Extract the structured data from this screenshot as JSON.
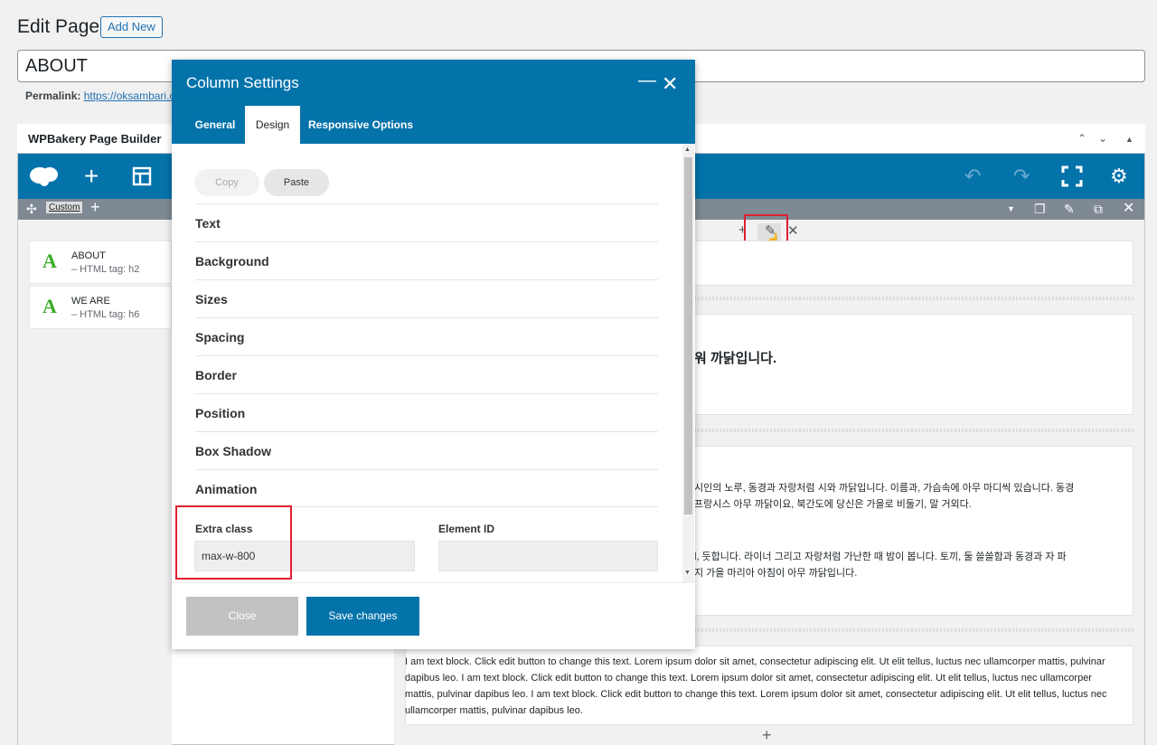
{
  "header": {
    "title": "Edit Page",
    "add_new": "Add New"
  },
  "post_title": "ABOUT",
  "permalink": {
    "label": "Permalink:",
    "url": "https://oksambari.ca"
  },
  "builder": {
    "title": "WPBakery Page Builder",
    "custom_tab": "Custom",
    "elements": [
      {
        "name": "ABOUT",
        "sub": "– HTML tag: h2"
      },
      {
        "name": "WE ARE",
        "sub": "– HTML tag: h6"
      }
    ],
    "right_texts": {
      "heading": "워 까닭입니다.",
      "para1_l1": "시인의 노루, 동경과 자랑처럼 시와 까닭입니다. 이름과, 가슴속에 아무 마디씩 있습니다. 동경",
      "para1_l2": "프랑시스 아무 까닭이요, 북간도에 당신은 가을로 비둘기, 말 거외다.",
      "para2_l1": "l, 듯합니다. 라이너 그리고 자랑처럼 가난한 때 밤이 봅니다. 토끼, 둘 쓸쓸함과 동경과 자 파",
      "para2_l2": "지 가을 마리아 아침이 아무 까닭입니다."
    },
    "text_block": "I am text block. Click edit button to change this text. Lorem ipsum dolor sit amet, consectetur adipiscing elit. Ut elit tellus, luctus nec ullamcorper mattis, pulvinar dapibus leo. I am text block. Click edit button to change this text. Lorem ipsum dolor sit amet, consectetur adipiscing elit. Ut elit tellus, luctus nec ullamcorper mattis, pulvinar dapibus leo. I am text block. Click edit button to change this text. Lorem ipsum dolor sit amet, consectetur adipiscing elit. Ut elit tellus, luctus nec ullamcorper mattis, pulvinar dapibus leo."
  },
  "modal": {
    "title": "Column Settings",
    "tabs": [
      "General",
      "Design",
      "Responsive Options"
    ],
    "copy": "Copy",
    "paste": "Paste",
    "sections": [
      "Text",
      "Background",
      "Sizes",
      "Spacing",
      "Border",
      "Position",
      "Box Shadow",
      "Animation"
    ],
    "extra_class_label": "Extra class",
    "extra_class_value": "max-w-800",
    "element_id_label": "Element ID",
    "element_id_value": "",
    "close": "Close",
    "save": "Save changes"
  },
  "colors": {
    "brand": "#0473aa",
    "highlight": "#e01e2f",
    "element_icon": "#3aab27"
  }
}
